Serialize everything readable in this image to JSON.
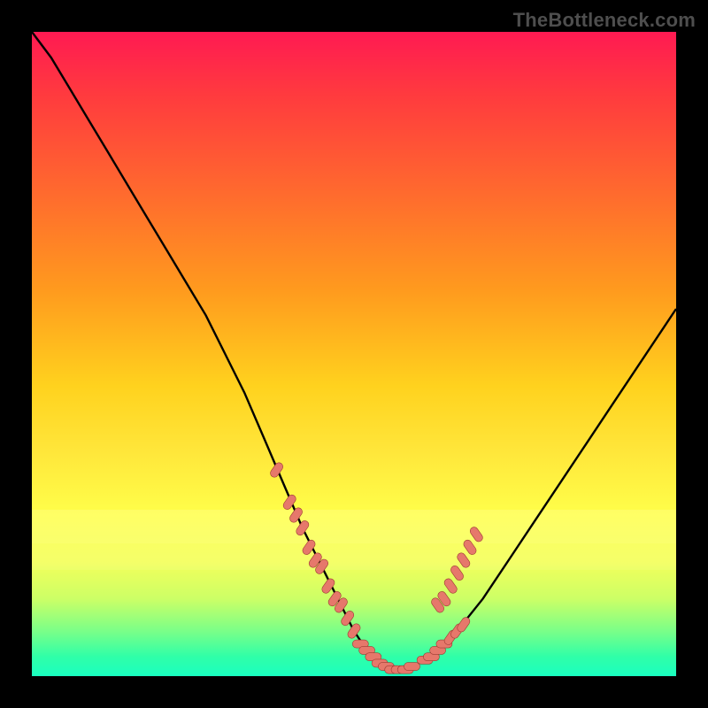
{
  "watermark": "TheBottleneck.com",
  "colors": {
    "frame": "#000000",
    "curve": "#000000",
    "marker": "#e6786b",
    "marker_stroke": "#9c3a32"
  },
  "chart_data": {
    "type": "line",
    "title": "",
    "xlabel": "",
    "ylabel": "",
    "xlim": [
      0,
      100
    ],
    "ylim": [
      0,
      100
    ],
    "grid": false,
    "series": [
      {
        "name": "bottleneck-curve",
        "x": [
          0,
          3,
          6,
          9,
          12,
          15,
          18,
          21,
          24,
          27,
          30,
          33,
          36,
          39,
          42,
          45,
          48,
          50,
          52,
          54,
          56,
          58,
          60,
          62,
          64,
          66,
          70,
          74,
          78,
          82,
          86,
          90,
          94,
          98,
          100
        ],
        "values": [
          100,
          96,
          91,
          86,
          81,
          76,
          71,
          66,
          61,
          56,
          50,
          44,
          37,
          30,
          23,
          17,
          11,
          7,
          4,
          2,
          1,
          1,
          2,
          3,
          5,
          7,
          12,
          18,
          24,
          30,
          36,
          42,
          48,
          54,
          57
        ]
      }
    ],
    "highlighted_points": {
      "name": "salmon-markers",
      "x": [
        38,
        40,
        41,
        42,
        43,
        44,
        45,
        46,
        47,
        48,
        49,
        50,
        51,
        52,
        53,
        54,
        55,
        56,
        57,
        58,
        59,
        61,
        62,
        63,
        64,
        65,
        66,
        67
      ],
      "values": [
        32,
        27,
        25,
        23,
        20,
        18,
        17,
        14,
        12,
        11,
        9,
        7,
        5,
        4,
        3,
        2,
        1.5,
        1,
        1,
        1,
        1.5,
        2.5,
        3,
        4,
        5,
        6,
        7,
        8
      ]
    },
    "right_valley_markers": {
      "name": "right-wall-markers",
      "x": [
        63,
        64,
        65,
        66,
        67,
        68,
        69
      ],
      "values": [
        11,
        12,
        14,
        16,
        18,
        20,
        22
      ]
    }
  }
}
